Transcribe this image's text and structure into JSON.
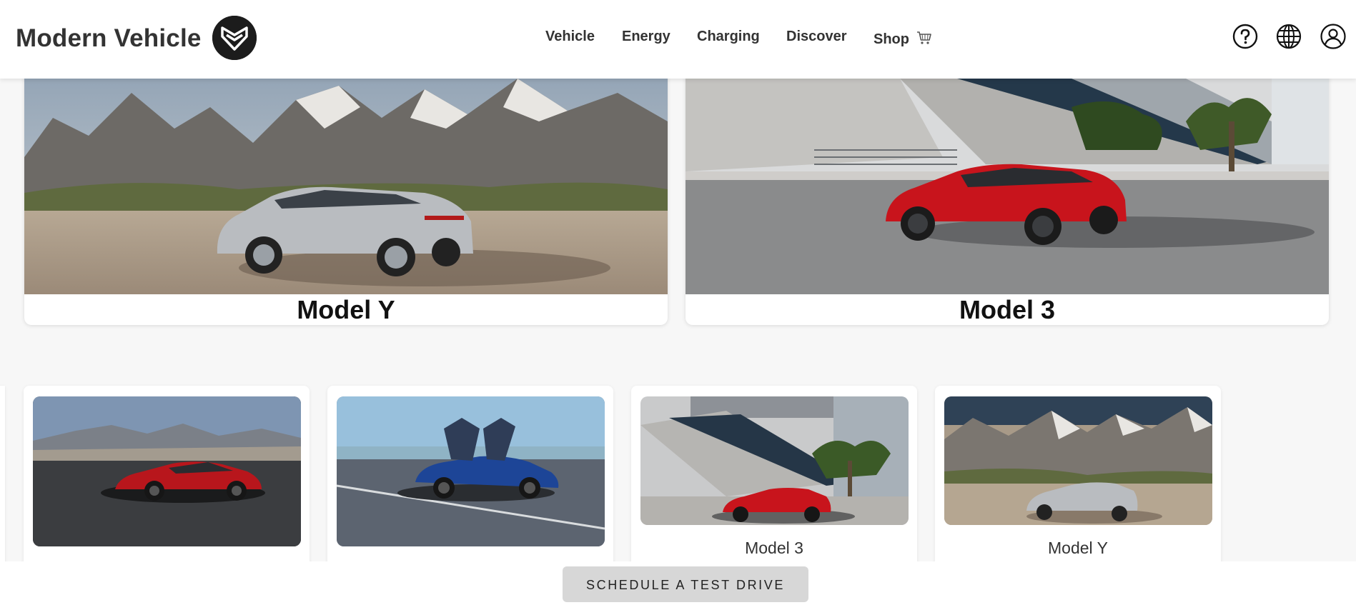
{
  "header": {
    "brand": "Modern Vehicle",
    "logo": "mv-shield-logo",
    "nav": [
      {
        "label": "Vehicle"
      },
      {
        "label": "Energy"
      },
      {
        "label": "Charging"
      },
      {
        "label": "Discover"
      },
      {
        "label": "Shop",
        "icon": "cart-icon"
      }
    ],
    "icons": [
      "help-icon",
      "globe-icon",
      "user-icon"
    ]
  },
  "featured": [
    {
      "title": "Model Y",
      "image": "silver Model Y in mountain desert",
      "car_color": "#b9bcc0"
    },
    {
      "title": "Model 3",
      "image": "red Model 3 in front of modern building",
      "car_color": "#c8141c"
    }
  ],
  "carousel": [
    {
      "label": "",
      "image": "red Model S in desert",
      "car_color": "#b8161c"
    },
    {
      "label": "",
      "image": "blue Model X with falcon doors open",
      "car_color": "#1d4597"
    },
    {
      "label": "Model 3",
      "image": "red Model 3 by building",
      "car_color": "#c8141c"
    },
    {
      "label": "Model Y",
      "image": "silver Model Y in mountains",
      "car_color": "#b9bcc0"
    }
  ],
  "cta": {
    "label": "SCHEDULE A TEST DRIVE"
  },
  "colors": {
    "header_bg": "#ffffff",
    "page_bg": "#f7f7f7",
    "cta_bg": "#d7d7d7",
    "logo_bg": "#1c1c1c"
  }
}
